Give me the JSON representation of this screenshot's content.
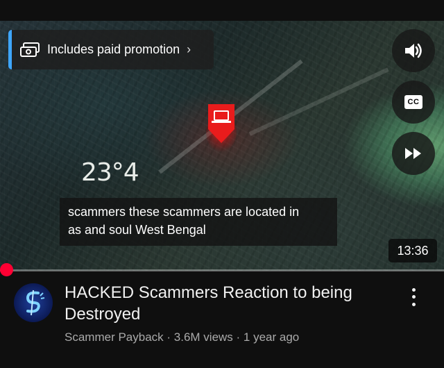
{
  "video": {
    "promotion_label": "Includes paid promotion",
    "overlay_coordinate": "23°4",
    "caption_line1": "scammers these scammers are located in",
    "caption_line2": "as and soul West Bengal",
    "duration": "13:36",
    "progress_fraction": 0.0
  },
  "controls": {
    "volume_icon": "speaker-volume-icon",
    "cc_label": "CC",
    "skip_icon": "fast-forward-icon"
  },
  "details": {
    "title": "HACKED Scammers Reaction to being Destroyed",
    "channel": "Scammer Payback",
    "views": "3.6M views",
    "age": "1 year ago",
    "separator": " · "
  },
  "colors": {
    "background": "#0f0f0f",
    "progress": "#ff0033",
    "promo_accent": "#3ea6ff",
    "meta_text": "#aaaaaa"
  }
}
